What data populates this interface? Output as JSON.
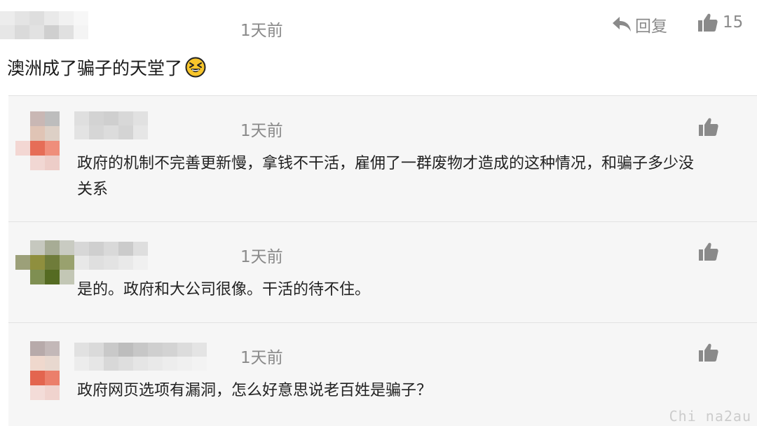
{
  "main_comment": {
    "time": "1天前",
    "reply_label": "回复",
    "like_count": "15",
    "text": "澳洲成了骗子的天堂了",
    "emoji": "laughing-squint-emoji"
  },
  "replies": [
    {
      "time": "1天前",
      "text_line1": "政府的机制不完善更新慢，拿钱不干活，雇佣了一群废物才造成的这种情况，和骗子多少没",
      "text_line2": "关系"
    },
    {
      "time": "1天前",
      "text_line1": "是的。政府和大公司很像。干活的待不住。"
    },
    {
      "time": "1天前",
      "text_line1": "政府网页选项有漏洞，怎么好意思说老百姓是骗子？"
    }
  ],
  "watermark": "Chi na2au",
  "colors": {
    "reply_bg": "#f6f6f6",
    "meta_gray": "#8a8a8a"
  }
}
